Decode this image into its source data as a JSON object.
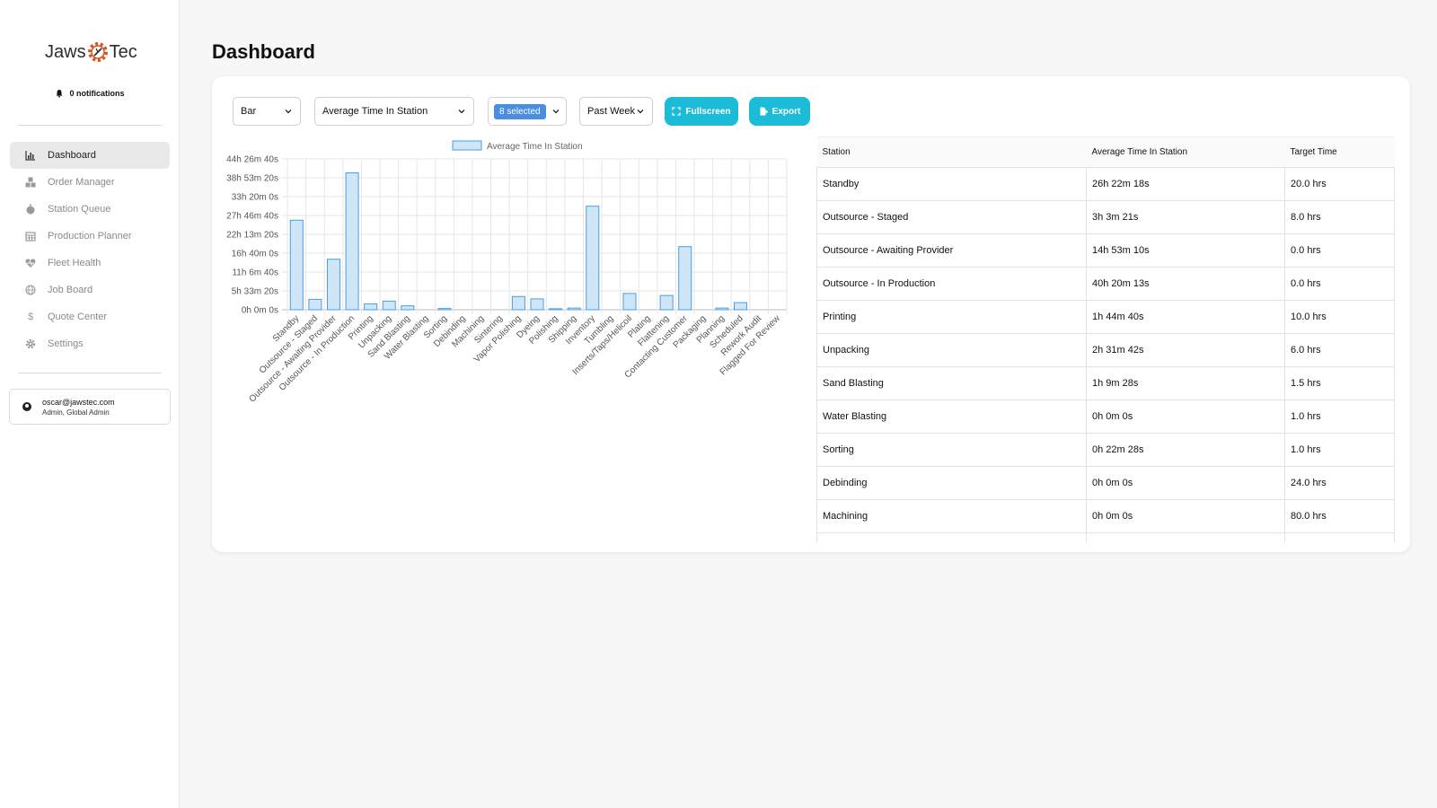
{
  "sidebar": {
    "logo": {
      "left": "Jaws",
      "right": "Tec"
    },
    "notifications": "0 notifications",
    "nav": [
      {
        "label": "Dashboard",
        "icon": "bar-chart-icon",
        "active": true
      },
      {
        "label": "Order Manager",
        "icon": "boxes-icon",
        "active": false
      },
      {
        "label": "Station Queue",
        "icon": "stopwatch-icon",
        "active": false
      },
      {
        "label": "Production Planner",
        "icon": "calendar-icon",
        "active": false
      },
      {
        "label": "Fleet Health",
        "icon": "heart-pulse-icon",
        "active": false
      },
      {
        "label": "Job Board",
        "icon": "globe-icon",
        "active": false
      },
      {
        "label": "Quote Center",
        "icon": "dollar-icon",
        "active": false
      },
      {
        "label": "Settings",
        "icon": "gear-icon",
        "active": false
      }
    ],
    "user": {
      "email": "oscar@jawstec.com",
      "role": "Admin, Global Admin"
    }
  },
  "main": {
    "title": "Dashboard",
    "controls": {
      "chart_type": "Bar",
      "metric": "Average Time In Station",
      "stations_selected": "8 selected",
      "range": "Past Week",
      "fullscreen": "Fullscreen",
      "export": "Export"
    },
    "colors": {
      "accent": "#1cbcd8",
      "bar_fill": "#cfe5f8",
      "bar_stroke": "#4a9ee6"
    },
    "table": {
      "headers": [
        "Station",
        "Average Time In Station",
        "Target Time"
      ],
      "rows": [
        [
          "Standby",
          "26h 22m 18s",
          "20.0 hrs"
        ],
        [
          "Outsource - Staged",
          "3h 3m 21s",
          "8.0 hrs"
        ],
        [
          "Outsource - Awaiting Provider",
          "14h 53m 10s",
          "0.0 hrs"
        ],
        [
          "Outsource - In Production",
          "40h 20m 13s",
          "0.0 hrs"
        ],
        [
          "Printing",
          "1h 44m 40s",
          "10.0 hrs"
        ],
        [
          "Unpacking",
          "2h 31m 42s",
          "6.0 hrs"
        ],
        [
          "Sand Blasting",
          "1h 9m 28s",
          "1.5 hrs"
        ],
        [
          "Water Blasting",
          "0h 0m 0s",
          "1.0 hrs"
        ],
        [
          "Sorting",
          "0h 22m 28s",
          "1.0 hrs"
        ],
        [
          "Debinding",
          "0h 0m 0s",
          "24.0 hrs"
        ],
        [
          "Machining",
          "0h 0m 0s",
          "80.0 hrs"
        ],
        [
          "",
          "",
          ""
        ]
      ]
    }
  },
  "chart_data": {
    "type": "bar",
    "legend": "Average Time In Station",
    "legend_position": "top",
    "grid": true,
    "y_tick_labels": [
      "0h 0m 0s",
      "5h 33m 20s",
      "11h 6m 40s",
      "16h 40m 0s",
      "22h 13m 20s",
      "27h 46m 40s",
      "33h 20m 0s",
      "38h 53m 20s",
      "44h 26m 40s"
    ],
    "ylim_hours": [
      0,
      44.44
    ],
    "categories": [
      "Standby",
      "Outsource - Staged",
      "Outsource - Awaiting Provider",
      "Outsource - In Production",
      "Printing",
      "Unpacking",
      "Sand Blasting",
      "Water Blasting",
      "Sorting",
      "Debinding",
      "Machining",
      "Sintering",
      "Vapor Polishing",
      "Dyeing",
      "Polishing",
      "Shipping",
      "Inventory",
      "Tumbling",
      "Inserts/Taps/Helicoil",
      "Plating",
      "Flattening",
      "Contacting Customer",
      "Packaging",
      "Planning",
      "Scheduled",
      "Rework Audit",
      "Flagged For Review"
    ],
    "values_hours": [
      26.37,
      3.06,
      14.89,
      40.34,
      1.74,
      2.53,
      1.16,
      0,
      0.37,
      0,
      0,
      0,
      3.9,
      3.2,
      0.3,
      0.5,
      30.5,
      0,
      4.8,
      0,
      4.2,
      18.6,
      0,
      0.5,
      2.1,
      0,
      0
    ]
  }
}
